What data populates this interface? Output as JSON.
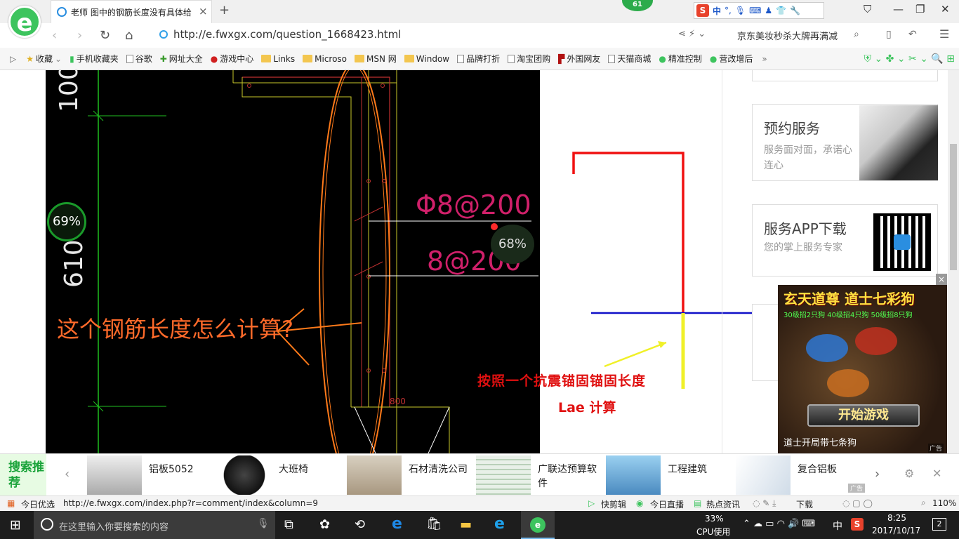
{
  "browser": {
    "tab_title": "老师 图中的钢筋长度没有具体给",
    "notify_count": "61",
    "url": "http://e.fwxgx.com/question_1668423.html",
    "search_promo": "京东美妆秒杀大牌再满减",
    "ime_label": "中",
    "accent": "#3dc45e"
  },
  "bookmarks": [
    {
      "label": "收藏",
      "icon": "star-icon"
    },
    {
      "label": "手机收藏夹",
      "icon": "phone-icon"
    },
    {
      "label": "谷歌",
      "icon": "page-icon"
    },
    {
      "label": "网址大全",
      "icon": "site-icon"
    },
    {
      "label": "游戏中心",
      "icon": "game-icon"
    },
    {
      "label": "Links",
      "icon": "folder-icon"
    },
    {
      "label": "Microso",
      "icon": "folder-icon"
    },
    {
      "label": "MSN 网",
      "icon": "folder-icon"
    },
    {
      "label": "Window",
      "icon": "folder-icon"
    },
    {
      "label": "品牌打折",
      "icon": "page-icon"
    },
    {
      "label": "淘宝团购",
      "icon": "page-icon"
    },
    {
      "label": "外国网友",
      "icon": "flag-icon"
    },
    {
      "label": "天猫商城",
      "icon": "page-icon"
    },
    {
      "label": "精准控制",
      "icon": "chat-icon"
    },
    {
      "label": "营改增后",
      "icon": "chat-icon"
    }
  ],
  "drawing": {
    "dim_top": "100",
    "dim_side": "610",
    "rebar1": "Φ8@200",
    "rebar2": "8@200",
    "question": "这个钢筋长度怎么计算?",
    "dim_bottom": "800",
    "gauge_left": "69%",
    "gauge_right": "68%"
  },
  "annotation": {
    "line1": "按照一个抗震锚固锚固长度",
    "line2": "Lae 计算"
  },
  "sidebar": {
    "booking_title": "预约服务",
    "booking_desc": "服务面对面，承诺心连心",
    "app_title": "服务APP下载",
    "app_desc": "您的掌上服务专家"
  },
  "ad": {
    "headline": "玄天道尊 道士七彩狗",
    "subline": "30级招2只狗 40级招4只狗 50级招8只狗",
    "button": "开始游戏",
    "caption": "道士开局带七条狗",
    "tag": "广告"
  },
  "recommend": {
    "label": "搜索推荐",
    "items": [
      {
        "label": "铝板5052"
      },
      {
        "label": "大班椅"
      },
      {
        "label": "石材清洗公司"
      },
      {
        "label": "广联达预算软件"
      },
      {
        "label": "工程建筑"
      },
      {
        "label": "复合铝板"
      }
    ],
    "ad_tag": "广告"
  },
  "status": {
    "left": "今日优选",
    "url": "http://e.fwxgx.com/index.php?r=comment/index&column=9",
    "items": [
      "快剪辑",
      "今日直播",
      "热点资讯",
      "下载"
    ],
    "zoom": "110%"
  },
  "taskbar": {
    "search_placeholder": "在这里输入你要搜索的内容",
    "cpu_pct": "33%",
    "cpu_label": "CPU使用",
    "lang": "中",
    "time": "8:25",
    "date": "2017/10/17",
    "notif": "2"
  }
}
